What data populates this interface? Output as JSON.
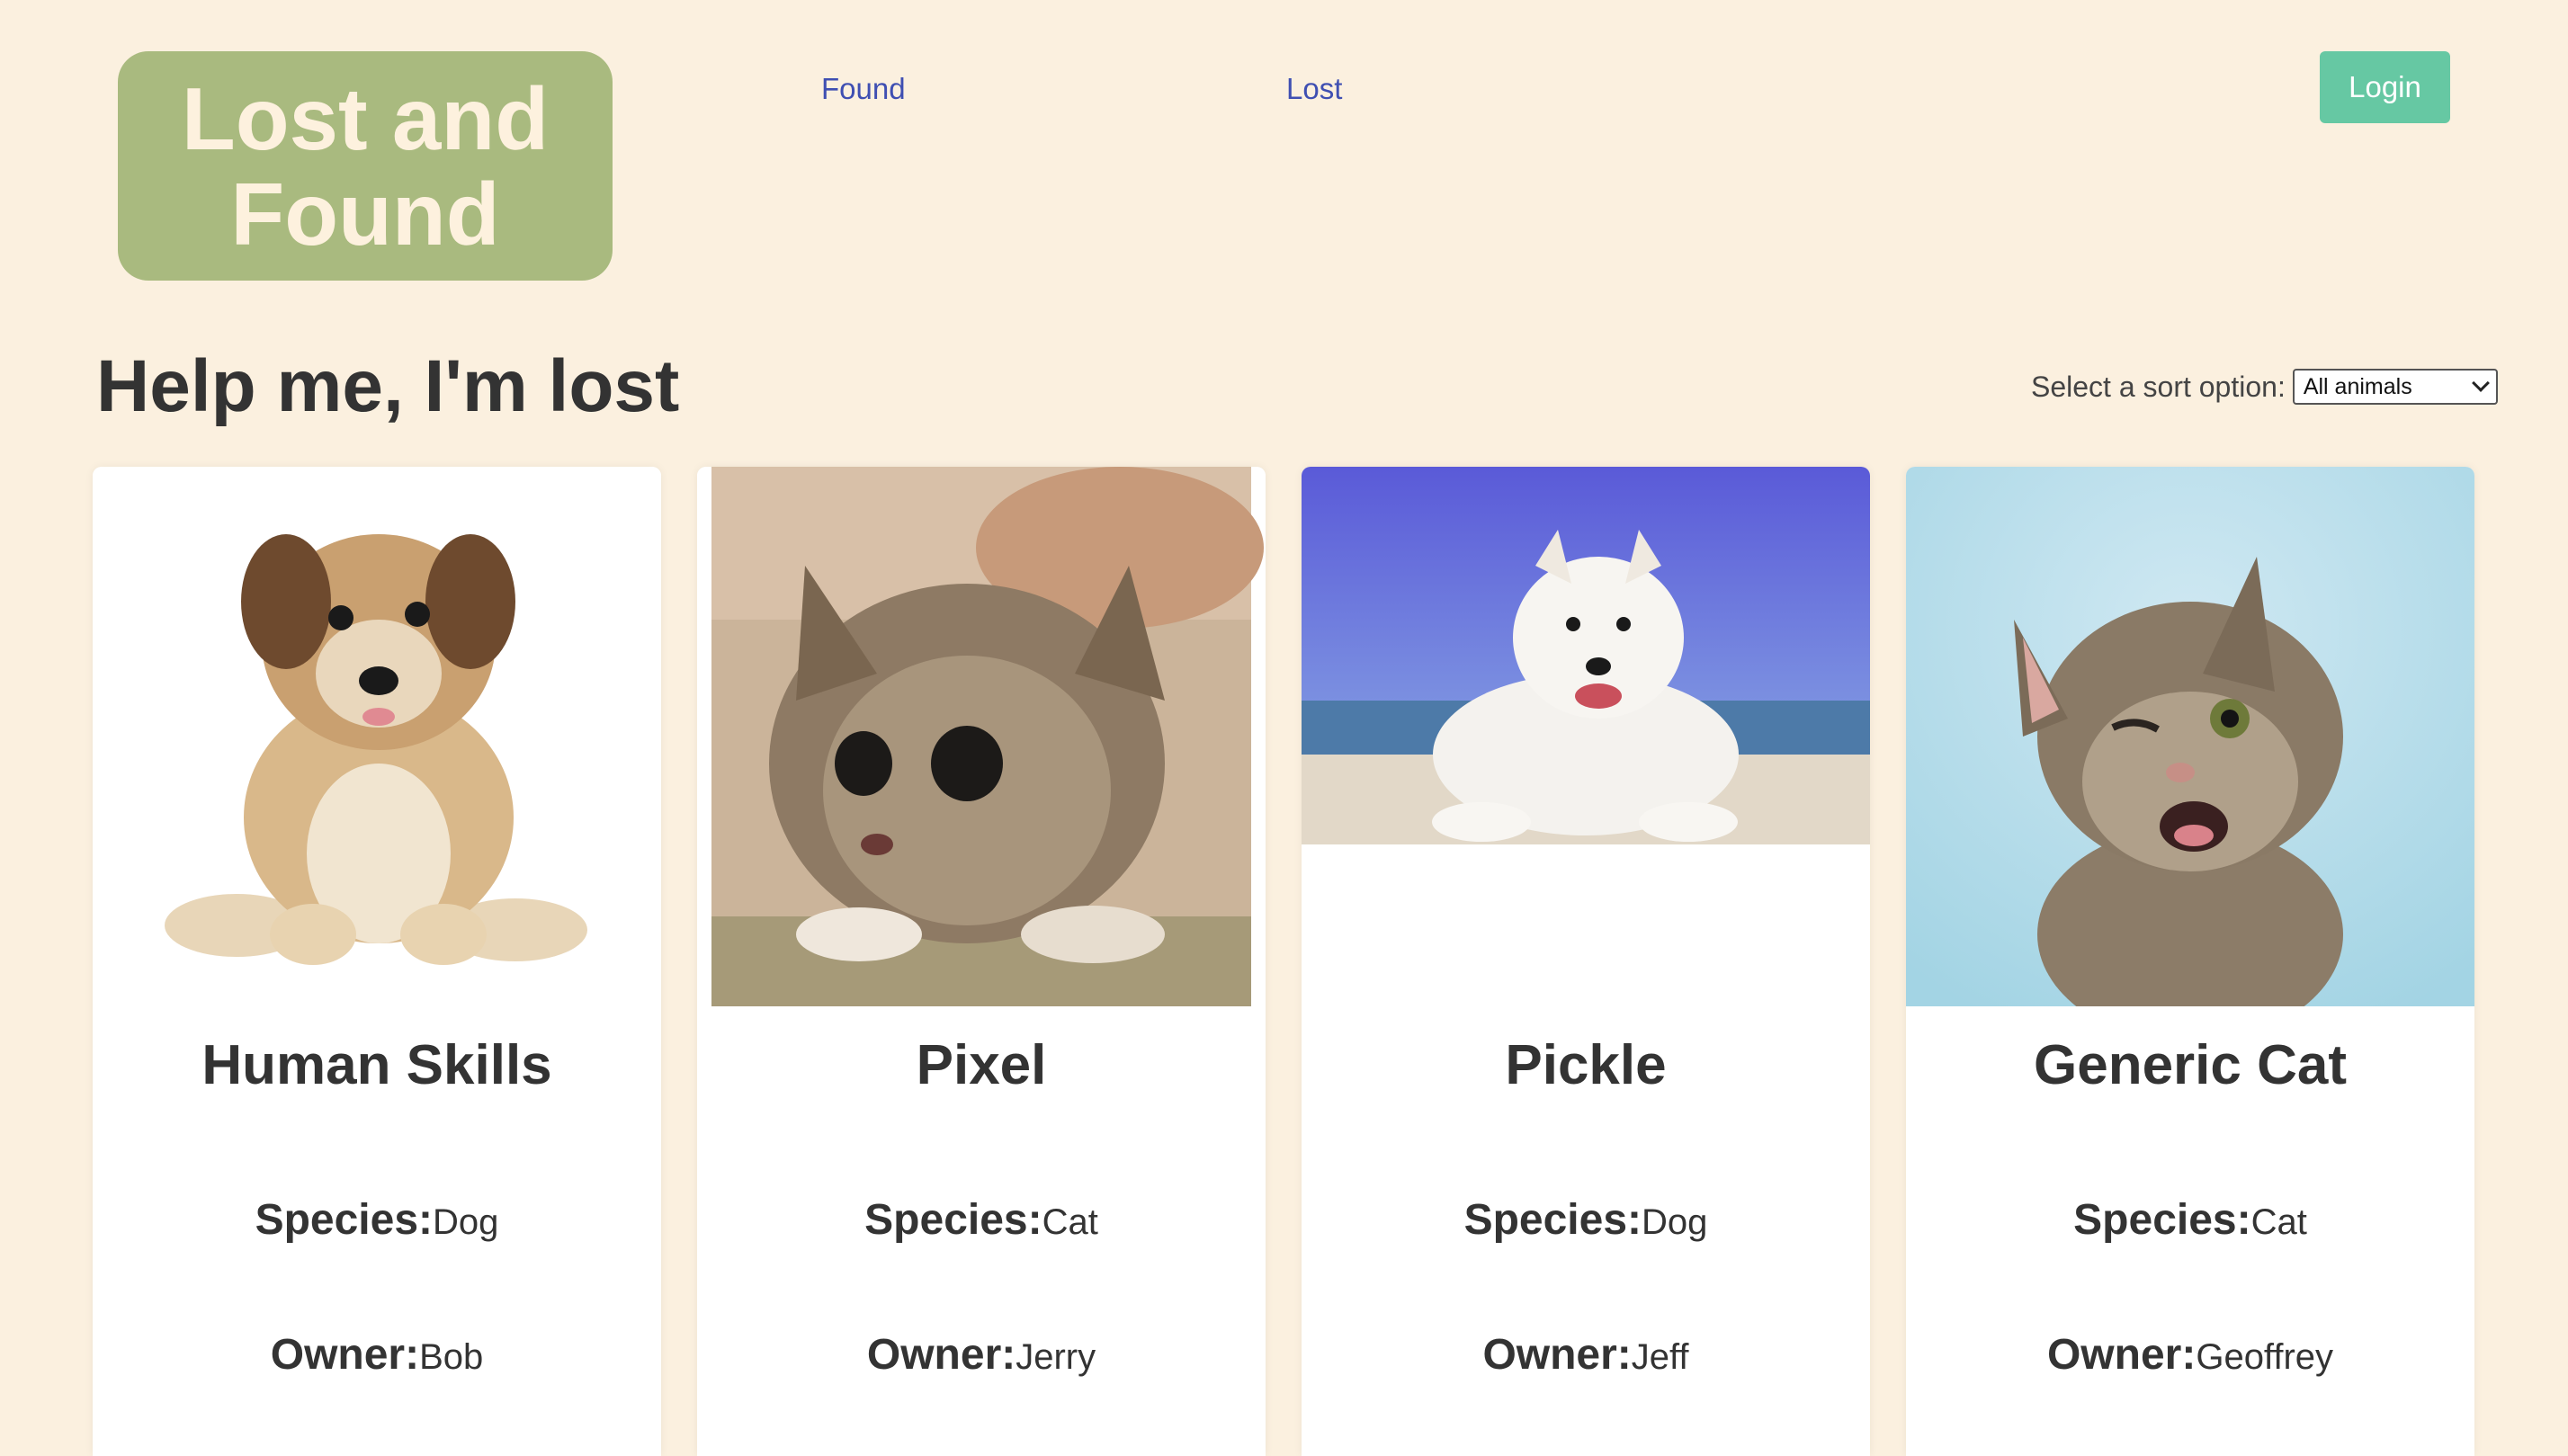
{
  "header": {
    "logo_line1": "Lost and",
    "logo_line2": "Found",
    "nav": [
      {
        "label": "Found"
      },
      {
        "label": "Lost"
      }
    ],
    "login_label": "Login"
  },
  "page": {
    "title": "Help me, I'm lost",
    "sort_label": "Select a sort option:",
    "sort_value": "All animals"
  },
  "cards": [
    {
      "name": "Human Skills",
      "species_label": "Species:",
      "species": "Dog",
      "owner_label": "Owner:",
      "owner": "Bob",
      "image": "puppy-photo"
    },
    {
      "name": "Pixel",
      "species_label": "Species:",
      "species": "Cat",
      "owner_label": "Owner:",
      "owner": "Jerry",
      "image": "kitten-photo"
    },
    {
      "name": "Pickle",
      "species_label": "Species:",
      "species": "Dog",
      "owner_label": "Owner:",
      "owner": "Jeff",
      "image": "white-puppy-beach-photo"
    },
    {
      "name": "Generic Cat",
      "species_label": "Species:",
      "species": "Cat",
      "owner_label": "Owner:",
      "owner": "Geoffrey",
      "image": "winking-kitten-photo"
    }
  ],
  "colors": {
    "background": "#fbf0df",
    "logo_bg": "#a9ba7f",
    "nav_link": "#3f4fb2",
    "login_bg": "#66c8a3"
  }
}
